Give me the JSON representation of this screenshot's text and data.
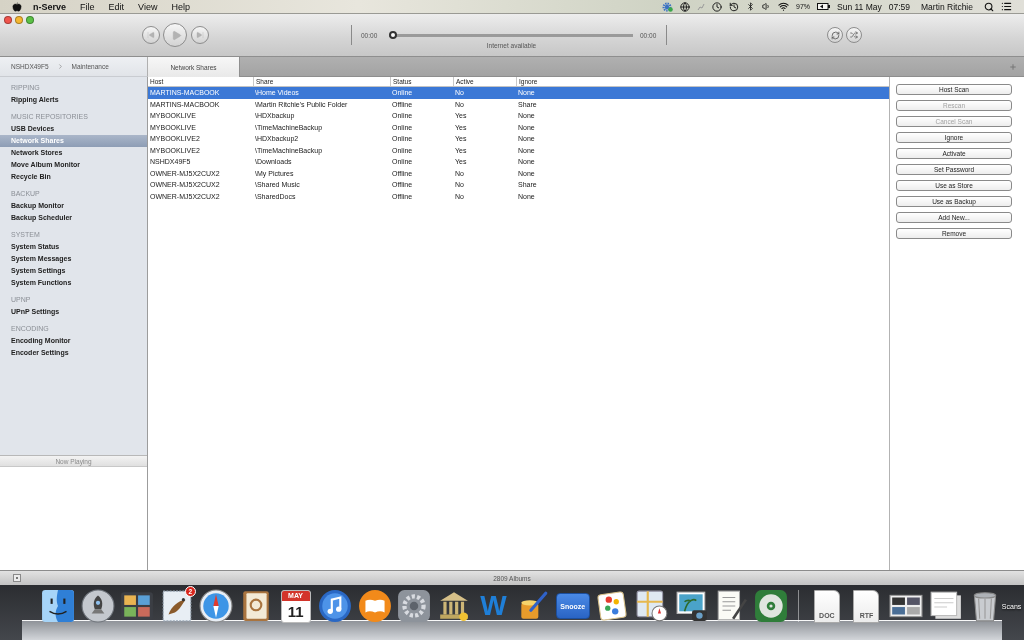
{
  "menu_bar": {
    "app_name": "n-Serve",
    "menus": [
      "File",
      "Edit",
      "View",
      "Help"
    ],
    "battery": "97%",
    "date": "Sun 11 May",
    "time": "07:59",
    "user": "Martin Ritchie"
  },
  "player": {
    "elapsed": "00:00",
    "remaining": "00:00",
    "level": 0,
    "status": "Internet available"
  },
  "breadcrumb": [
    "NSHDX49F5",
    "Maintenance"
  ],
  "tabs": [
    {
      "label": "Network Shares",
      "selected": true
    }
  ],
  "sidebar": {
    "sections": [
      {
        "title": "RIPPING",
        "items": [
          {
            "label": "Ripping Alerts",
            "selected": false
          }
        ]
      },
      {
        "title": "MUSIC REPOSITORIES",
        "items": [
          {
            "label": "USB Devices",
            "selected": false
          },
          {
            "label": "Network Shares",
            "selected": true
          },
          {
            "label": "Network Stores",
            "selected": false
          },
          {
            "label": "Move Album Monitor",
            "selected": false
          },
          {
            "label": "Recycle Bin",
            "selected": false
          }
        ]
      },
      {
        "title": "BACKUP",
        "items": [
          {
            "label": "Backup Monitor",
            "selected": false
          },
          {
            "label": "Backup Scheduler",
            "selected": false
          }
        ]
      },
      {
        "title": "SYSTEM",
        "items": [
          {
            "label": "System Status",
            "selected": false
          },
          {
            "label": "System Messages",
            "selected": false
          },
          {
            "label": "System Settings",
            "selected": false
          },
          {
            "label": "System Functions",
            "selected": false
          }
        ]
      },
      {
        "title": "UPNP",
        "items": [
          {
            "label": "UPnP Settings",
            "selected": false
          }
        ]
      },
      {
        "title": "ENCODING",
        "items": [
          {
            "label": "Encoding Monitor",
            "selected": false
          },
          {
            "label": "Encoder Settings",
            "selected": false
          }
        ]
      }
    ]
  },
  "table": {
    "columns": [
      "Host",
      "Share",
      "Status",
      "Active",
      "Ignore"
    ],
    "rows": [
      {
        "cells": [
          "MARTINS-MACBOOK",
          "\\Home Videos",
          "Online",
          "No",
          "None"
        ],
        "selected": true
      },
      {
        "cells": [
          "MARTINS-MACBOOK",
          "\\Martin Ritchie's Public Folder",
          "Offline",
          "No",
          "Share"
        ],
        "selected": false
      },
      {
        "cells": [
          "MYBOOKLIVE",
          "\\HDXbackup",
          "Online",
          "Yes",
          "None"
        ],
        "selected": false
      },
      {
        "cells": [
          "MYBOOKLIVE",
          "\\TimeMachineBackup",
          "Online",
          "Yes",
          "None"
        ],
        "selected": false
      },
      {
        "cells": [
          "MYBOOKLIVE2",
          "\\HDXbackup2",
          "Online",
          "Yes",
          "None"
        ],
        "selected": false
      },
      {
        "cells": [
          "MYBOOKLIVE2",
          "\\TimeMachineBackup",
          "Online",
          "Yes",
          "None"
        ],
        "selected": false
      },
      {
        "cells": [
          "NSHDX49F5",
          "\\Downloads",
          "Online",
          "Yes",
          "None"
        ],
        "selected": false
      },
      {
        "cells": [
          "OWNER-MJ5X2CUX2",
          "\\My Pictures",
          "Offline",
          "No",
          "None"
        ],
        "selected": false
      },
      {
        "cells": [
          "OWNER-MJ5X2CUX2",
          "\\Shared Music",
          "Offline",
          "No",
          "Share"
        ],
        "selected": false
      },
      {
        "cells": [
          "OWNER-MJ5X2CUX2",
          "\\SharedDocs",
          "Offline",
          "No",
          "None"
        ],
        "selected": false
      }
    ]
  },
  "actions": [
    {
      "label": "Host Scan",
      "disabled": false
    },
    {
      "label": "Rescan",
      "disabled": true
    },
    {
      "label": "Cancel Scan",
      "disabled": true
    },
    {
      "label": "Ignore",
      "disabled": false
    },
    {
      "label": "Activate",
      "disabled": false
    },
    {
      "label": "Set Password",
      "disabled": false
    },
    {
      "label": "Use as Store",
      "disabled": false
    },
    {
      "label": "Use as Backup",
      "disabled": false
    },
    {
      "label": "Add New...",
      "disabled": false
    },
    {
      "label": "Remove",
      "disabled": false
    }
  ],
  "now_playing": {
    "title": "Now Playing"
  },
  "status_bar": {
    "albums": "2809 Albums"
  },
  "dock": {
    "mail_badge": "2",
    "calendar_month": "MAY",
    "calendar_day": "11",
    "letter_w": "W",
    "snooze": "Snooze",
    "documents": [
      "DOC",
      "RTF"
    ]
  },
  "desktop_label": "Scans"
}
